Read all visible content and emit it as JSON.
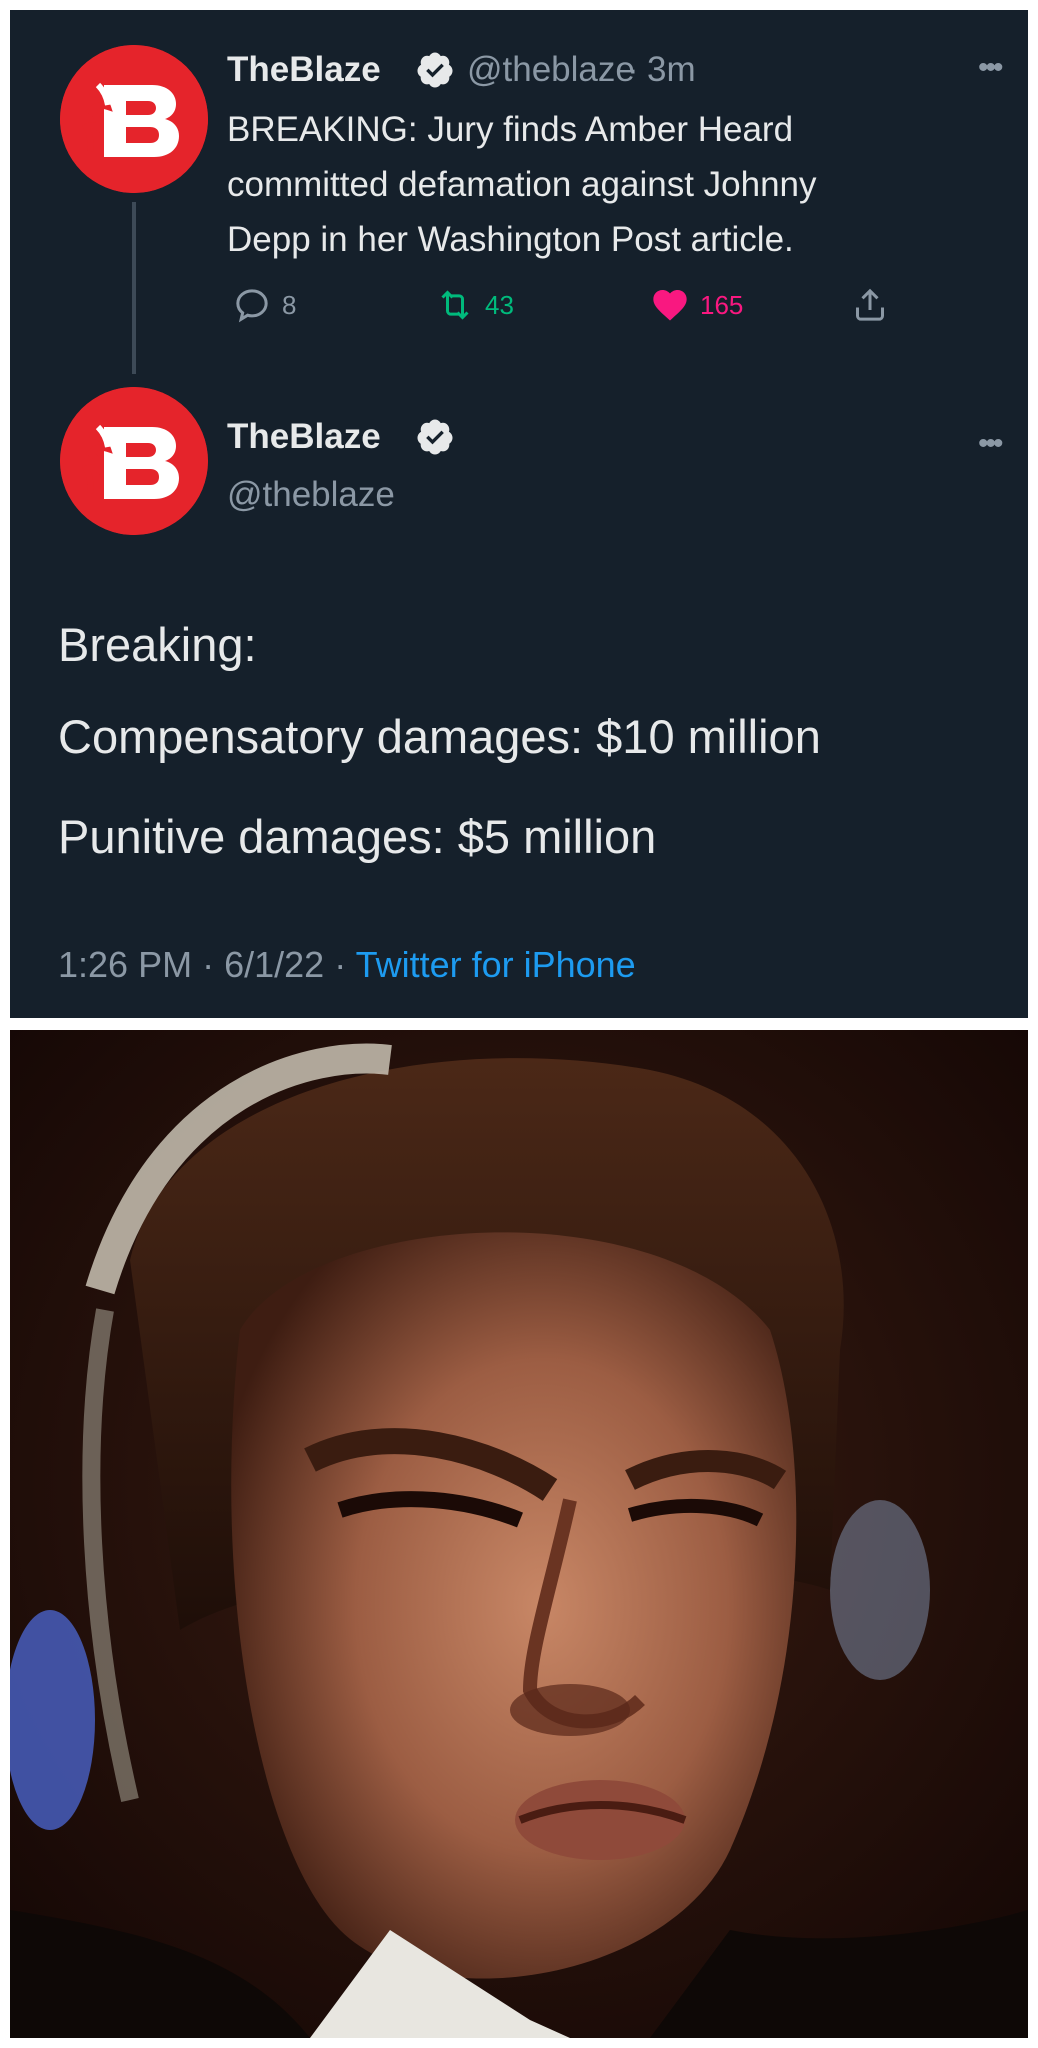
{
  "thread": {
    "first_tweet": {
      "display_name": "TheBlaze",
      "handle": "@theblaze",
      "separator": "·",
      "time_ago": "3m",
      "more_icon": "more-horizontal-icon",
      "text_lines": [
        "BREAKING: Jury finds Amber Heard",
        "committed defamation against Johnny",
        "Depp in her Washington Post article."
      ],
      "actions": {
        "reply": {
          "icon": "reply-icon",
          "count": "8"
        },
        "retweet": {
          "icon": "retweet-icon",
          "count": "43"
        },
        "like": {
          "icon": "heart-icon",
          "count": "165"
        },
        "share": {
          "icon": "share-icon"
        }
      }
    },
    "main_tweet": {
      "display_name": "TheBlaze",
      "handle": "@theblaze",
      "more_icon": "more-horizontal-icon",
      "text_lines": [
        "Breaking:",
        "Compensatory damages: $10 million",
        "Punitive damages: $5 million"
      ],
      "timestamp_time": "1:26 PM",
      "timestamp_date": "6/1/22",
      "separator": "·",
      "source": "Twitter for iPhone"
    }
  },
  "meme_image": {
    "description_icon": "reaction-face-image"
  },
  "colors": {
    "background": "#15202b",
    "brand_red": "#e5242b",
    "text": "#e7e9ea",
    "muted": "#8b98a5",
    "link": "#1d9bf0",
    "retweet_green": "#00ba7c",
    "like_pink": "#f91880"
  }
}
